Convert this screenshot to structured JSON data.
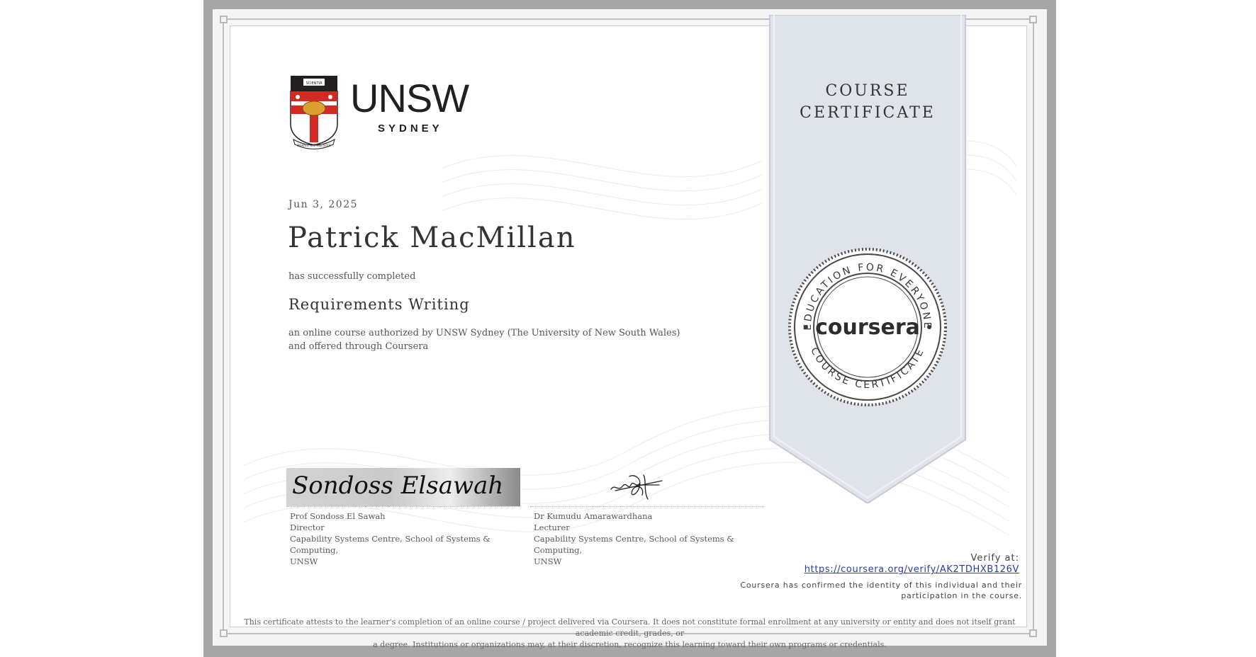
{
  "certificate": {
    "date": "Jun 3, 2025",
    "recipient_name": "Patrick MacMillan",
    "completed_text": "has successfully completed",
    "course_name": "Requirements Writing",
    "description": "an online course authorized by UNSW Sydney (The University of New South Wales) and offered through Coursera",
    "ribbon_line1": "COURSE",
    "ribbon_line2": "CERTIFICATE"
  },
  "logo": {
    "word": "UNSW",
    "sub": "SYDNEY",
    "crest_banner_top": "SCIENTIA",
    "crest_banner_bottom": "MANU ET MENTE"
  },
  "seal": {
    "brand": "coursera",
    "ring_top": "EDUCATION FOR EVERYONE",
    "ring_bottom": "COURSE CERTIFICATE"
  },
  "signatories": [
    {
      "signature_text": "Sondoss Elsawah",
      "name": "Prof Sondoss El Sawah",
      "role": "Director",
      "affiliation_line1": "Capability Systems Centre, School of Systems & Computing,",
      "affiliation_line2": "UNSW"
    },
    {
      "name": "Dr Kumudu Amarawardhana",
      "role": "Lecturer",
      "affiliation_line1": "Capability Systems Centre, School of Systems & Computing,",
      "affiliation_line2": "UNSW"
    }
  ],
  "verify": {
    "label": "Verify at:",
    "url": "https://coursera.org/verify/AK2TDHXB126V",
    "identity_line1": "Coursera has confirmed the identity of this individual and their",
    "identity_line2": "participation in the course."
  },
  "footer": {
    "line1": "This certificate attests to the learner's completion of an online course / project delivered via Coursera. It does not constitute formal enrollment at any university or entity and does not itself grant academic credit, grades, or",
    "line2": "a degree. Institutions or organizations may, at their discretion, recognize this learning toward their own programs or credentials."
  },
  "colors": {
    "frame_gray": "#a6a6a6",
    "ribbon_fill": "#dfe3ea",
    "link_blue": "#2a3ca8",
    "crest_red": "#d42a24"
  }
}
